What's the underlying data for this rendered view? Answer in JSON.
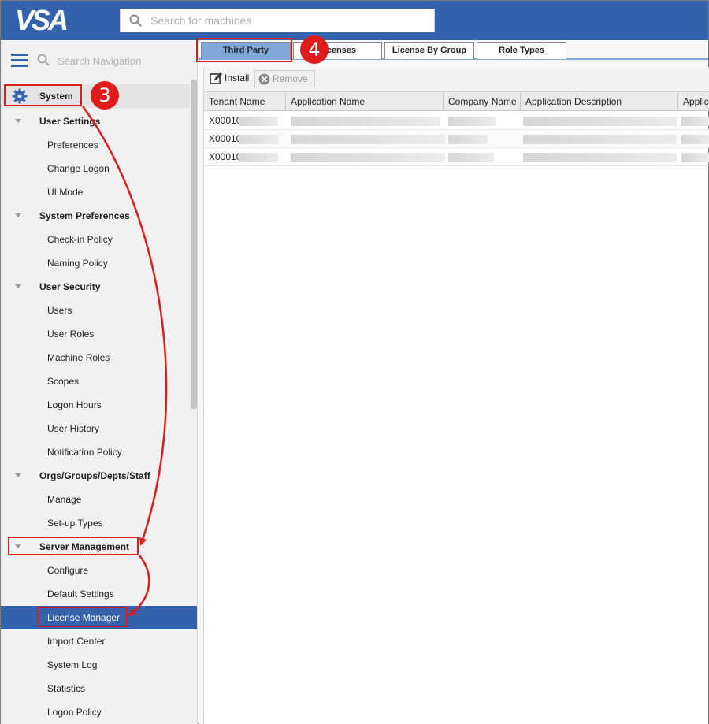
{
  "header": {
    "logo_text": "VSA",
    "search_placeholder": "Search for machines"
  },
  "sidebar": {
    "search_placeholder": "Search Navigation",
    "root": "System",
    "items": [
      {
        "label": "User Settings",
        "kind": "group"
      },
      {
        "label": "Preferences",
        "kind": "leaf"
      },
      {
        "label": "Change Logon",
        "kind": "leaf"
      },
      {
        "label": "UI Mode",
        "kind": "leaf"
      },
      {
        "label": "System Preferences",
        "kind": "group"
      },
      {
        "label": "Check-in Policy",
        "kind": "leaf"
      },
      {
        "label": "Naming Policy",
        "kind": "leaf"
      },
      {
        "label": "User Security",
        "kind": "group"
      },
      {
        "label": "Users",
        "kind": "leaf"
      },
      {
        "label": "User Roles",
        "kind": "leaf"
      },
      {
        "label": "Machine Roles",
        "kind": "leaf"
      },
      {
        "label": "Scopes",
        "kind": "leaf"
      },
      {
        "label": "Logon Hours",
        "kind": "leaf"
      },
      {
        "label": "User History",
        "kind": "leaf"
      },
      {
        "label": "Notification Policy",
        "kind": "leaf"
      },
      {
        "label": "Orgs/Groups/Depts/Staff",
        "kind": "group"
      },
      {
        "label": "Manage",
        "kind": "leaf"
      },
      {
        "label": "Set-up Types",
        "kind": "leaf"
      },
      {
        "label": "Server Management",
        "kind": "group"
      },
      {
        "label": "Configure",
        "kind": "leaf"
      },
      {
        "label": "Default Settings",
        "kind": "leaf"
      },
      {
        "label": "License Manager",
        "kind": "leaf",
        "active": true
      },
      {
        "label": "Import Center",
        "kind": "leaf"
      },
      {
        "label": "System Log",
        "kind": "leaf"
      },
      {
        "label": "Statistics",
        "kind": "leaf"
      },
      {
        "label": "Logon Policy",
        "kind": "leaf"
      }
    ]
  },
  "tabs": {
    "third_party": "Third Party",
    "licenses": "Licenses",
    "license_by_group": "License By Group",
    "role_types": "Role Types"
  },
  "toolbar": {
    "install": "Install",
    "remove": "Remove"
  },
  "grid": {
    "columns": [
      "Tenant Name",
      "Application Name",
      "Company Name",
      "Application Description",
      "Applic"
    ],
    "rows": [
      {
        "tenant": "X00010"
      },
      {
        "tenant": "X00010"
      },
      {
        "tenant": "X00010"
      }
    ]
  },
  "annotations": {
    "step3": "3",
    "step4": "4"
  },
  "colors": {
    "brand_blue": "#3562ad",
    "tab_selected": "#7fa8d8",
    "annotation_red": "#e01b1b"
  }
}
